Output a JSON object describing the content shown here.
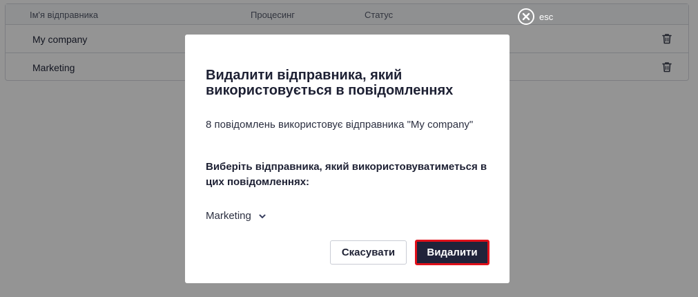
{
  "table": {
    "headers": {
      "name": "Ім'я відправника",
      "processing": "Процесинг",
      "status": "Статус"
    },
    "rows": [
      {
        "name": "My company"
      },
      {
        "name": "Marketing"
      }
    ]
  },
  "overlay": {
    "close_label": "esc"
  },
  "modal": {
    "title": "Видалити відправника, який використовується в повідомленнях",
    "description": "8 повідомлень використовує відправника \"My company\"",
    "select_label": "Виберіть відправника, який використовуватиметься в цих повідомленнях:",
    "select_value": "Marketing",
    "cancel_label": "Скасувати",
    "delete_label": "Видалити"
  },
  "colors": {
    "overlay": "#000000",
    "primary_button": "#20233a",
    "highlight_border": "#e0101a"
  },
  "icons": {
    "row_action": "trash-icon",
    "close": "close-icon",
    "select": "chevron-down-icon"
  }
}
